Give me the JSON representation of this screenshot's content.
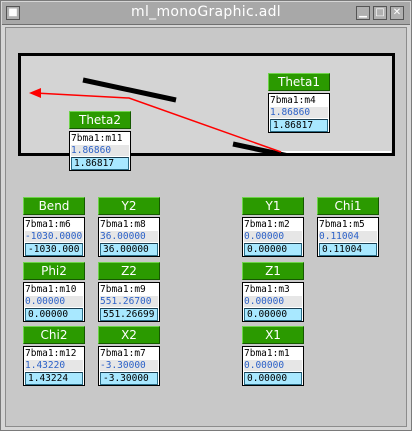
{
  "window": {
    "title": "ml_monoGraphic.adl"
  },
  "widgets": [
    {
      "key": "theta1",
      "button": "Theta1",
      "pv": "7bma1:m4",
      "readback": "1.86860",
      "input": "1.86817"
    },
    {
      "key": "theta2",
      "button": "Theta2",
      "pv": "7bma1:m11",
      "readback": "1.86860",
      "input": "1.86817"
    },
    {
      "key": "bend",
      "button": "Bend",
      "pv": "7bma1:m6",
      "readback": "-1030.0000",
      "input": "-1030.000"
    },
    {
      "key": "y2",
      "button": "Y2",
      "pv": "7bma1:m8",
      "readback": "36.00000",
      "input": "36.00000"
    },
    {
      "key": "y1",
      "button": "Y1",
      "pv": "7bma1:m2",
      "readback": "0.00000",
      "input": "0.00000"
    },
    {
      "key": "chi1",
      "button": "Chi1",
      "pv": "7bma1:m5",
      "readback": "0.11004",
      "input": "0.11004"
    },
    {
      "key": "phi2",
      "button": "Phi2",
      "pv": "7bma1:m10",
      "readback": "0.00000",
      "input": "0.00000"
    },
    {
      "key": "z2",
      "button": "Z2",
      "pv": "7bma1:m9",
      "readback": "551.26700",
      "input": "551.26699"
    },
    {
      "key": "z1",
      "button": "Z1",
      "pv": "7bma1:m3",
      "readback": "0.00000",
      "input": "0.00000"
    },
    {
      "key": "chi2",
      "button": "Chi2",
      "pv": "7bma1:m12",
      "readback": "1.43220",
      "input": "1.43224"
    },
    {
      "key": "x2",
      "button": "X2",
      "pv": "7bma1:m7",
      "readback": "-3.30000",
      "input": "-3.30000"
    },
    {
      "key": "x1",
      "button": "X1",
      "pv": "7bma1:m1",
      "readback": "0.00000",
      "input": "0.00000"
    }
  ],
  "colors": {
    "button_bg": "#2b9a00",
    "readback_text": "#2d62c8",
    "input_bg": "#a8e8ff",
    "beam": "#ff0000",
    "crystal": "#000000"
  },
  "icons": [
    "menu-icon",
    "minimize-icon",
    "maximize-icon",
    "close-icon"
  ]
}
